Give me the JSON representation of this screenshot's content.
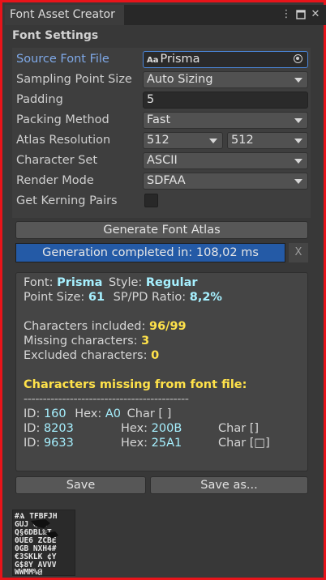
{
  "window": {
    "tab_title": "Font Asset Creator",
    "menu_icon": "kebab-menu-icon",
    "maximize_icon": "maximize-icon",
    "close_icon": "close-icon"
  },
  "section": {
    "title": "Font Settings"
  },
  "settings": {
    "source_font_label": "Source Font File",
    "source_font_value": "Prisma",
    "source_font_icon_text": "Aa",
    "sampling_label": "Sampling Point Size",
    "sampling_value": "Auto Sizing",
    "padding_label": "Padding",
    "padding_value": "5",
    "packing_label": "Packing Method",
    "packing_value": "Fast",
    "atlas_label": "Atlas Resolution",
    "atlas_width": "512",
    "atlas_height": "512",
    "charset_label": "Character Set",
    "charset_value": "ASCII",
    "render_label": "Render Mode",
    "render_value": "SDFAA",
    "kerning_label": "Get Kerning Pairs",
    "kerning_checked": false
  },
  "generate_button": "Generate Font Atlas",
  "progress": {
    "label": "Generation completed in: 108,02 ms",
    "fraction": 1.0,
    "cancel": "X"
  },
  "info": {
    "font_label": "Font:",
    "font_value": "Prisma",
    "style_label": "Style:",
    "style_value": "Regular",
    "point_label": "Point Size:",
    "point_value": "61",
    "ratio_label": "SP/PD Ratio:",
    "ratio_value": "8,2%",
    "included_label": "Characters included:",
    "included_value": "96/99",
    "missing_label": "Missing characters:",
    "missing_value": "3",
    "excluded_label": "Excluded characters:",
    "excluded_value": "0",
    "missing_header": "Characters missing from font file:",
    "divider": "-------------------------------------------",
    "missing": [
      {
        "id_label": "ID:",
        "id": "160",
        "hex_label": "Hex:",
        "hex": "A0",
        "char": "Char [ ]"
      },
      {
        "id_label": "ID:",
        "id": "8203",
        "hex_label": "Hex:",
        "hex": "200B",
        "char": "Char []"
      },
      {
        "id_label": "ID:",
        "id": "9633",
        "hex_label": "Hex:",
        "hex": "25A1",
        "char": "Char [□]"
      }
    ]
  },
  "save_button": "Save",
  "save_as_button": "Save as..."
}
